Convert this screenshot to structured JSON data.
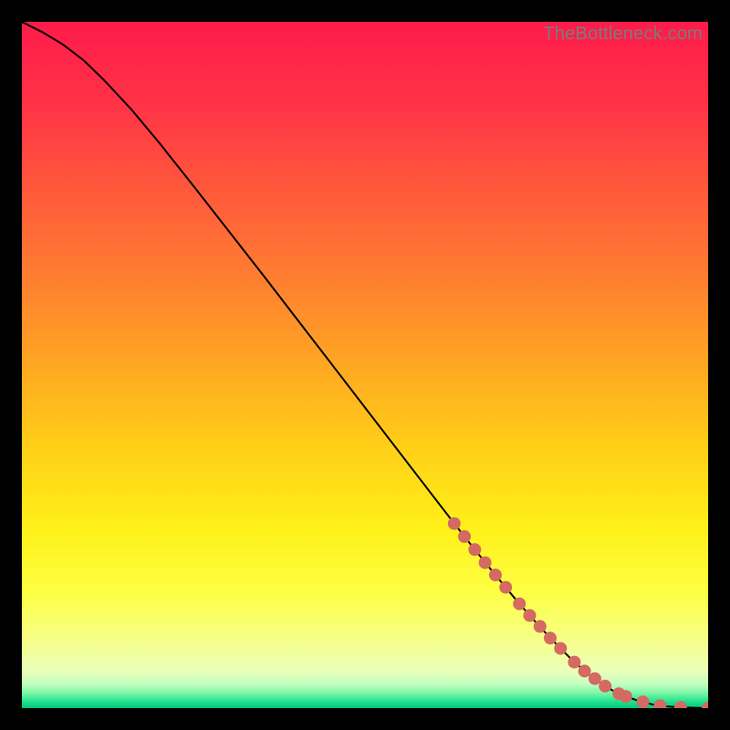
{
  "watermark": "TheBottleneck.com",
  "colors": {
    "frame": "#000000",
    "gradient_stops": [
      {
        "offset": 0.0,
        "color": "#ff1b4b"
      },
      {
        "offset": 0.12,
        "color": "#ff3346"
      },
      {
        "offset": 0.25,
        "color": "#ff5a3b"
      },
      {
        "offset": 0.38,
        "color": "#ff8030"
      },
      {
        "offset": 0.5,
        "color": "#ffa722"
      },
      {
        "offset": 0.62,
        "color": "#ffcf17"
      },
      {
        "offset": 0.74,
        "color": "#fff119"
      },
      {
        "offset": 0.83,
        "color": "#fdff43"
      },
      {
        "offset": 0.9,
        "color": "#f6ff87"
      },
      {
        "offset": 0.945,
        "color": "#eaffb8"
      },
      {
        "offset": 0.965,
        "color": "#c4ffbf"
      },
      {
        "offset": 0.978,
        "color": "#7cf7a6"
      },
      {
        "offset": 0.99,
        "color": "#23e38f"
      },
      {
        "offset": 1.0,
        "color": "#05c57c"
      }
    ],
    "curve": "#000000",
    "dot": "#d46a62"
  },
  "chart_data": {
    "type": "line",
    "title": "",
    "xlabel": "",
    "ylabel": "",
    "xlim": [
      0,
      100
    ],
    "ylim": [
      0,
      100
    ],
    "grid": false,
    "series": [
      {
        "name": "bottleneck-curve",
        "x": [
          0,
          3,
          6,
          9,
          12,
          16,
          20,
          25,
          30,
          35,
          40,
          45,
          50,
          55,
          60,
          63,
          66,
          69,
          72,
          74,
          76,
          78,
          80,
          82,
          84,
          86,
          88,
          90,
          92,
          94,
          96,
          98,
          100
        ],
        "y": [
          100,
          98.5,
          96.7,
          94.4,
          91.5,
          87.2,
          82.4,
          76.1,
          69.7,
          63.3,
          56.8,
          50.3,
          43.8,
          37.3,
          30.8,
          26.9,
          23.1,
          19.4,
          15.8,
          13.5,
          11.3,
          9.2,
          7.2,
          5.4,
          3.9,
          2.6,
          1.7,
          1.0,
          0.5,
          0.25,
          0.1,
          0.05,
          0.0
        ]
      }
    ],
    "highlight_dots": {
      "name": "sample-points",
      "x": [
        63,
        64.5,
        66,
        67.5,
        69,
        70.5,
        72.5,
        74,
        75.5,
        77,
        78.5,
        80.5,
        82,
        83.5,
        85,
        87,
        88,
        90.5,
        93,
        96,
        100
      ],
      "y": [
        26.9,
        25.0,
        23.1,
        21.2,
        19.4,
        17.6,
        15.2,
        13.5,
        11.9,
        10.2,
        8.7,
        6.7,
        5.4,
        4.3,
        3.2,
        2.1,
        1.7,
        0.9,
        0.35,
        0.1,
        0.0
      ]
    }
  }
}
